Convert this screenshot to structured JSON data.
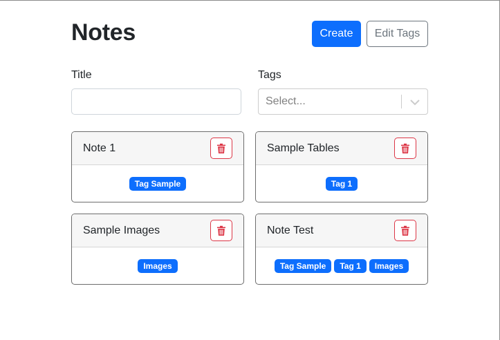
{
  "header": {
    "title": "Notes",
    "create_label": "Create",
    "edit_tags_label": "Edit Tags"
  },
  "form": {
    "title_label": "Title",
    "title_value": "",
    "tags_label": "Tags",
    "tags_placeholder": "Select..."
  },
  "notes": [
    {
      "title": "Note 1",
      "tags": [
        "Tag Sample"
      ]
    },
    {
      "title": "Sample Tables",
      "tags": [
        "Tag 1"
      ]
    },
    {
      "title": "Sample Images",
      "tags": [
        "Images"
      ]
    },
    {
      "title": "Note Test",
      "tags": [
        "Tag Sample",
        "Tag 1",
        "Images"
      ]
    }
  ],
  "colors": {
    "primary": "#0d6efd",
    "danger": "#dc3545",
    "secondary": "#6c757d"
  }
}
